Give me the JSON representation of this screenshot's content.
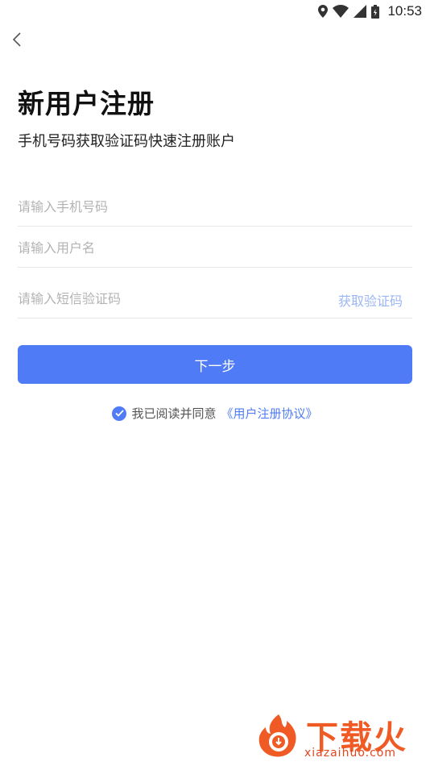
{
  "status_bar": {
    "time": "10:53",
    "icons": [
      "location-icon",
      "wifi-icon",
      "cell-signal-icon",
      "battery-icon"
    ]
  },
  "header": {
    "back_icon": "chevron-left-icon",
    "title": "新用户注册",
    "subtitle": "手机号码获取验证码快速注册账户"
  },
  "form": {
    "phone": {
      "value": "",
      "placeholder": "请输入手机号码"
    },
    "username": {
      "value": "",
      "placeholder": "请输入用户名"
    },
    "sms_code": {
      "value": "",
      "placeholder": "请输入短信验证码"
    },
    "get_code_label": "获取验证码",
    "next_label": "下一步"
  },
  "agreement": {
    "checked": true,
    "text": "我已阅读并同意",
    "link": "《用户注册协议》"
  },
  "watermark": {
    "brand": "下载火",
    "url": "xiazaihuo.com"
  },
  "colors": {
    "primary": "#4f7cf6",
    "get_code": "#9bb6f5",
    "placeholder": "#b3b3b3",
    "divider": "#e6e6e6",
    "watermark": "#f05a24"
  }
}
